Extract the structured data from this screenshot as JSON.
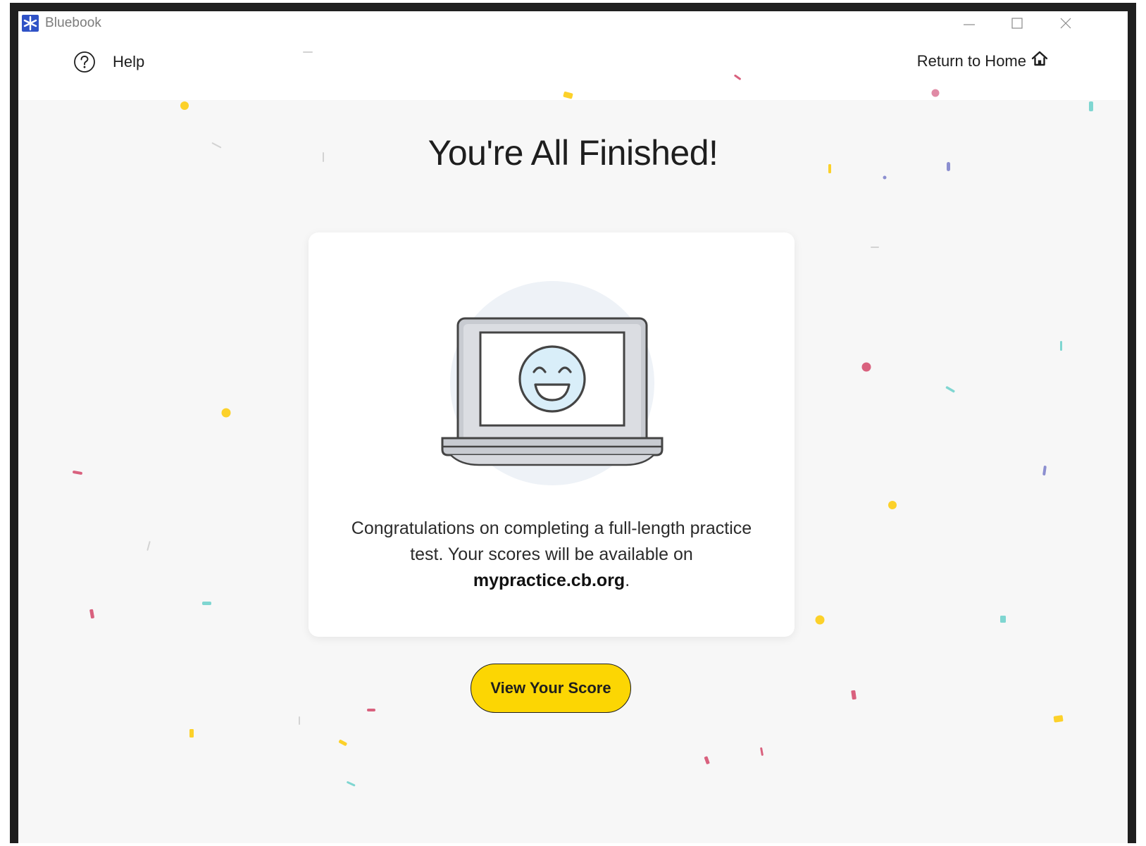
{
  "window": {
    "app_name": "Bluebook"
  },
  "header": {
    "help_label": "Help",
    "home_label": "Return to Home"
  },
  "main": {
    "title": "You're All Finished!",
    "message_before": "Congratulations on completing a full-length practice test. Your scores will be available on",
    "message_link": "mypractice.cb.org",
    "message_after": ".",
    "cta_label": "View Your Score"
  },
  "icons": {
    "app": "bluebook-logo-icon",
    "help": "question-circle-icon",
    "home": "house-icon",
    "illustration": "smiling-laptop-icon",
    "minimize": "minimize-icon",
    "maximize": "maximize-icon",
    "close": "close-icon"
  },
  "colors": {
    "accent_yellow": "#fcd603",
    "app_icon_blue": "#2f52c6",
    "background": "#f7f7f7",
    "card": "#ffffff",
    "confetti_pink": "#d9617e",
    "confetti_teal": "#7fd6d1",
    "confetti_purple": "#8c8fd0",
    "smiley_fill": "#d9eef9"
  }
}
